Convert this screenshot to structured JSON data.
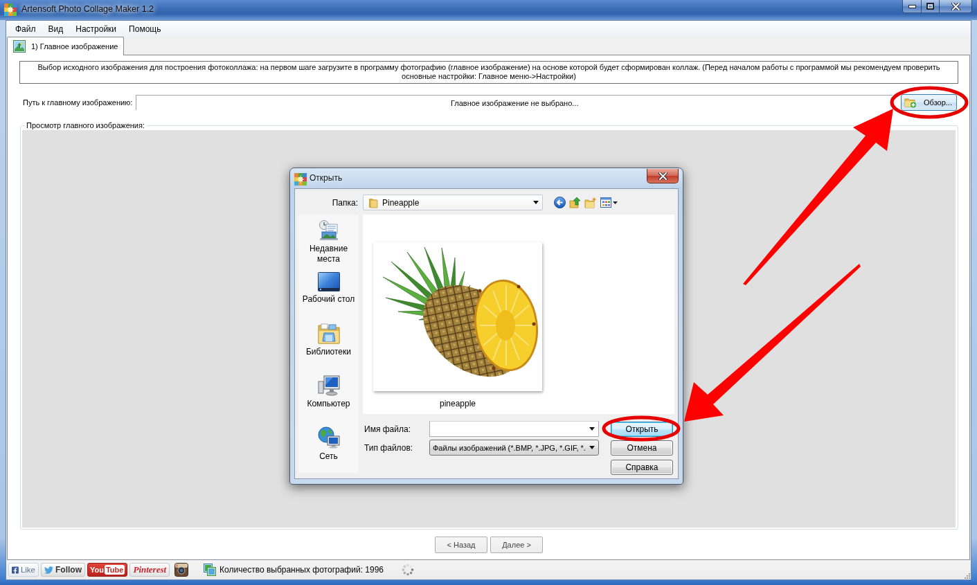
{
  "window": {
    "title": "Artensoft Photo Collage Maker 1.2"
  },
  "menu": [
    "Файл",
    "Вид",
    "Настройки",
    "Помощь"
  ],
  "tabs": [
    {
      "label": "1) Главное изображение",
      "selected": true
    }
  ],
  "description": "Выбор исходного изображения для построения фотоколлажа: на первом шаге загрузите в программу фотографию (главное изображение) на основе которой будет сформирован коллаж. (Перед началом работы с программой мы рекомендуем проверить основные настройки: Главное меню->Настройки)",
  "image_path": {
    "label": "Путь к главному изображению:",
    "value": "Главное изображение не выбрано...",
    "button": "Обзор..."
  },
  "preview": {
    "legend": "Просмотр главного изображения:"
  },
  "wizard_buttons": [
    "< Назад",
    "Далее >"
  ],
  "status_bar": {
    "social": [
      {
        "kind": "like",
        "label": "Like"
      },
      {
        "kind": "follow",
        "label": "Follow"
      },
      {
        "kind": "youtube",
        "label": "You",
        "label_2": "Tube"
      },
      {
        "kind": "pinterest",
        "label": "Pinterest"
      },
      {
        "kind": "instagram"
      }
    ],
    "photo_count": "Количество выбранных фотографий: 1996"
  },
  "dialog": {
    "title": "Открыть",
    "folder_label": "Папка:",
    "folder": "Pineapple",
    "places": [
      {
        "kind": "recent",
        "label": "Недавние места"
      },
      {
        "kind": "desktop",
        "label": "Рабочий стол"
      },
      {
        "kind": "libraries",
        "label": "Библиотеки"
      },
      {
        "kind": "computer",
        "label": "Компьютер"
      },
      {
        "kind": "network",
        "label": "Сеть"
      }
    ],
    "files": [
      {
        "name": "pineapple",
        "selected": false
      }
    ],
    "file_name_label": "Имя файла:",
    "file_type_label": "Тип файлов:",
    "file_type": "Файлы изображений (*.BMP, *.JPG, *.GIF, *.",
    "buttons": [
      {
        "label": "Открыть",
        "default": true
      },
      {
        "label": "Отмена",
        "default": false
      },
      {
        "label": "Справка",
        "default": false
      }
    ]
  }
}
